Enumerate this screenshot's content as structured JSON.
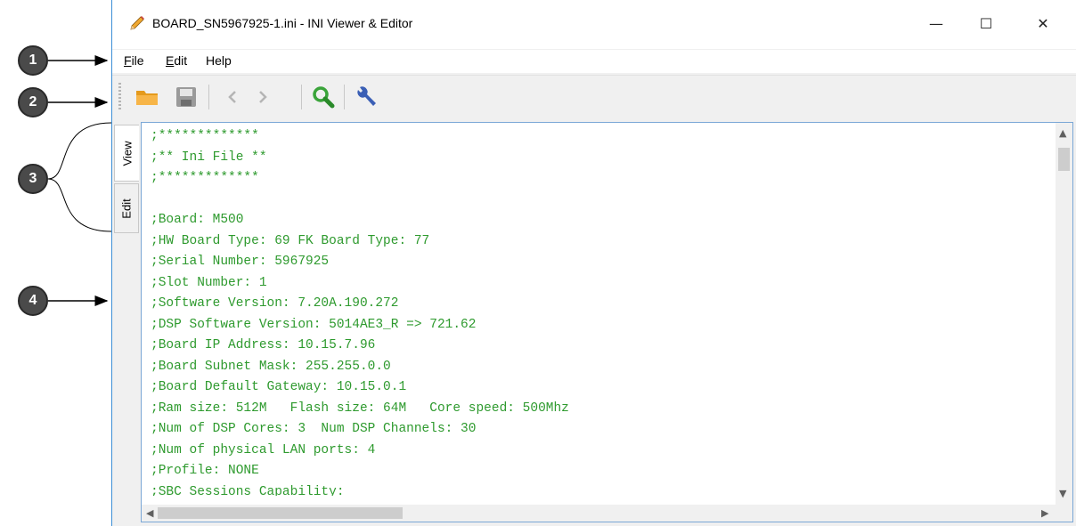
{
  "callouts": [
    "1",
    "2",
    "3",
    "4"
  ],
  "window": {
    "title": "BOARD_SN5967925-1.ini - INI Viewer & Editor",
    "minimize": "—",
    "maximize": "☐",
    "close": "✕"
  },
  "menu": {
    "file_label": "File",
    "edit_label": "Edit",
    "help_label": "Help"
  },
  "toolbar": {
    "buttons": [
      "open-folder-icon",
      "save-icon",
      "back-icon",
      "forward-icon",
      "search-icon",
      "settings-wrench-icon"
    ],
    "colors": {
      "folder": "#f5a623",
      "save": "#9a9a9a",
      "search": "#3aa43a",
      "wrench": "#3b5fb5"
    }
  },
  "tabs": {
    "view": "View",
    "edit": "Edit"
  },
  "editor": {
    "text_color": "#2e9a2e",
    "lines": [
      ";*************",
      ";** Ini File **",
      ";*************",
      "",
      ";Board: M500",
      ";HW Board Type: 69 FK Board Type: 77",
      ";Serial Number: 5967925",
      ";Slot Number: 1",
      ";Software Version: 7.20A.190.272",
      ";DSP Software Version: 5014AE3_R => 721.62",
      ";Board IP Address: 10.15.7.96",
      ";Board Subnet Mask: 255.255.0.0",
      ";Board Default Gateway: 10.15.0.1",
      ";Ram size: 512M   Flash size: 64M   Core speed: 500Mhz",
      ";Num of DSP Cores: 3  Num DSP Channels: 30",
      ";Num of physical LAN ports: 4",
      ";Profile: NONE",
      ";SBC Sessions Capability:"
    ]
  }
}
